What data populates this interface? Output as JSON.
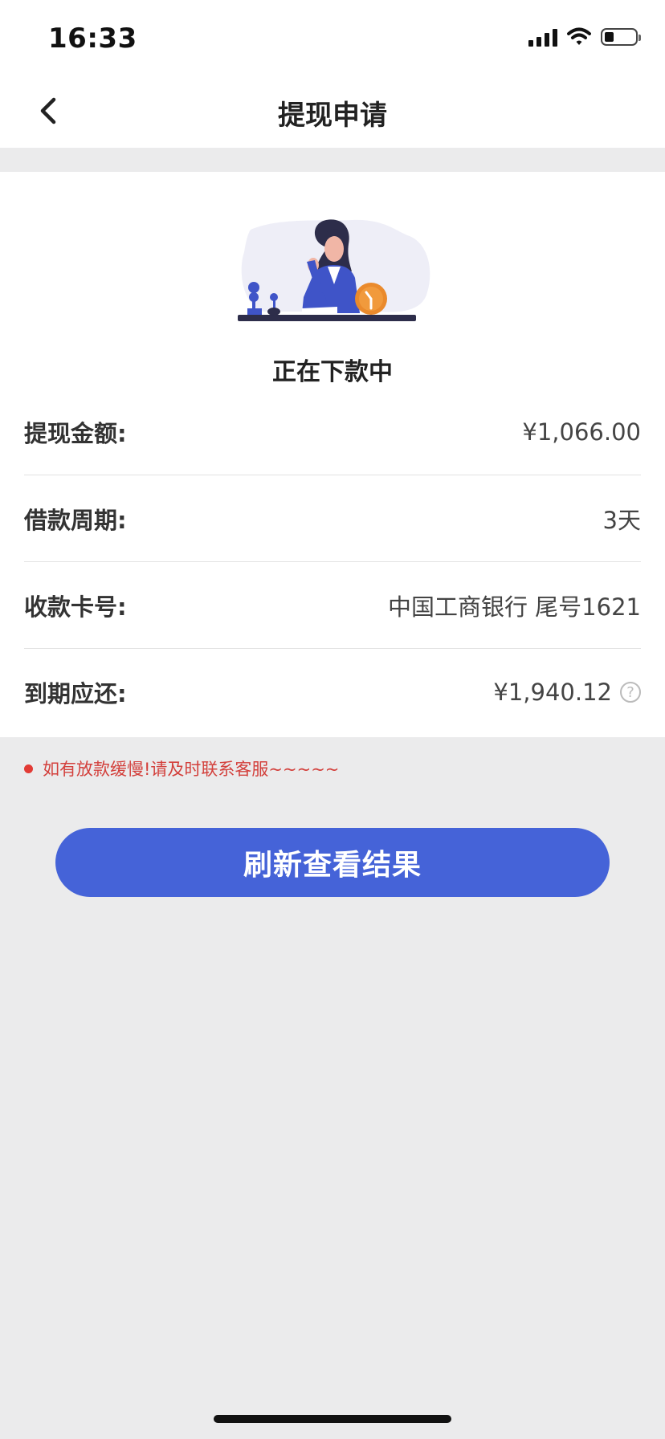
{
  "status_bar": {
    "time": "16:33"
  },
  "nav": {
    "title": "提现申请"
  },
  "card": {
    "status_text": "正在下款中",
    "rows": [
      {
        "label": "提现金额:",
        "value": "¥1,066.00"
      },
      {
        "label": "借款周期:",
        "value": "3天"
      },
      {
        "label": "收款卡号:",
        "value": "中国工商银行 尾号1621"
      },
      {
        "label": "到期应还:",
        "value": "¥1,940.12"
      }
    ]
  },
  "notice": {
    "text": "如有放款缓慢!请及时联系客服~~~~~"
  },
  "actions": {
    "refresh_label": "刷新查看结果"
  },
  "icons": {
    "back": "chevron-left-icon",
    "help": "question-circle-icon",
    "signal": "cellular-signal-icon",
    "wifi": "wifi-icon",
    "battery": "battery-icon"
  },
  "colors": {
    "accent": "#4563d8",
    "notice": "#d3403c",
    "background": "#ebebec"
  }
}
